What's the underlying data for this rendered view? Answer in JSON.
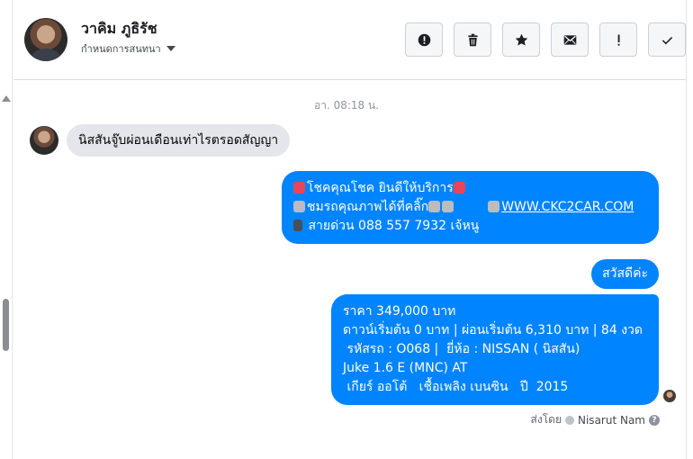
{
  "header": {
    "name": "วาคิม ภูธิรัช",
    "subtitle": "กำหนดการสนทนา",
    "toolbar": [
      {
        "icon": "alert-circle-icon",
        "name": "mark-spam-button"
      },
      {
        "icon": "trash-icon",
        "name": "delete-button"
      },
      {
        "icon": "star-icon",
        "name": "star-button"
      },
      {
        "icon": "envelope-icon",
        "name": "mark-unread-button"
      },
      {
        "icon": "exclamation-icon",
        "name": "follow-up-button"
      },
      {
        "icon": "checkmark-icon",
        "name": "mark-done-button"
      }
    ]
  },
  "conversation": {
    "timestamp": "อา. 08:18 น.",
    "incoming": "นิสสันจู๊บผ่อนเดือนเท่าไรตรอดสัญญา",
    "outgoing_promo": {
      "line1": "โชคคุณโชค ยินดีให้บริการ",
      "line2_text": "ชมรถคุณภาพได้ที่คลิ๊ก",
      "link": "WWW.CKC2CAR.COM",
      "line3": "สายด่วน 088 557 7932 เจ้หนู"
    },
    "greeting": "สวัสดีค่ะ",
    "details": [
      "ราคา 349,000 บาท",
      "ดาวน์เริ่มต้น 0 บาท | ผ่อนเริ่มต้น 6,310 บาท | 84 งวด",
      " รหัสรถ : O068 |  ยี่ห้อ : NISSAN ( นิสสัน)",
      "Juke 1.6 E (MNC) AT",
      " เกียร์ ออโต้   เชื้อเพลิง เบนซิน   ปี  2015"
    ],
    "sent_by_label": "ส่งโดย",
    "sent_by_name": "Nisarut Nam"
  },
  "colors": {
    "outgoing_bubble": "#0084ff",
    "incoming_bubble": "#e4e6eb"
  }
}
